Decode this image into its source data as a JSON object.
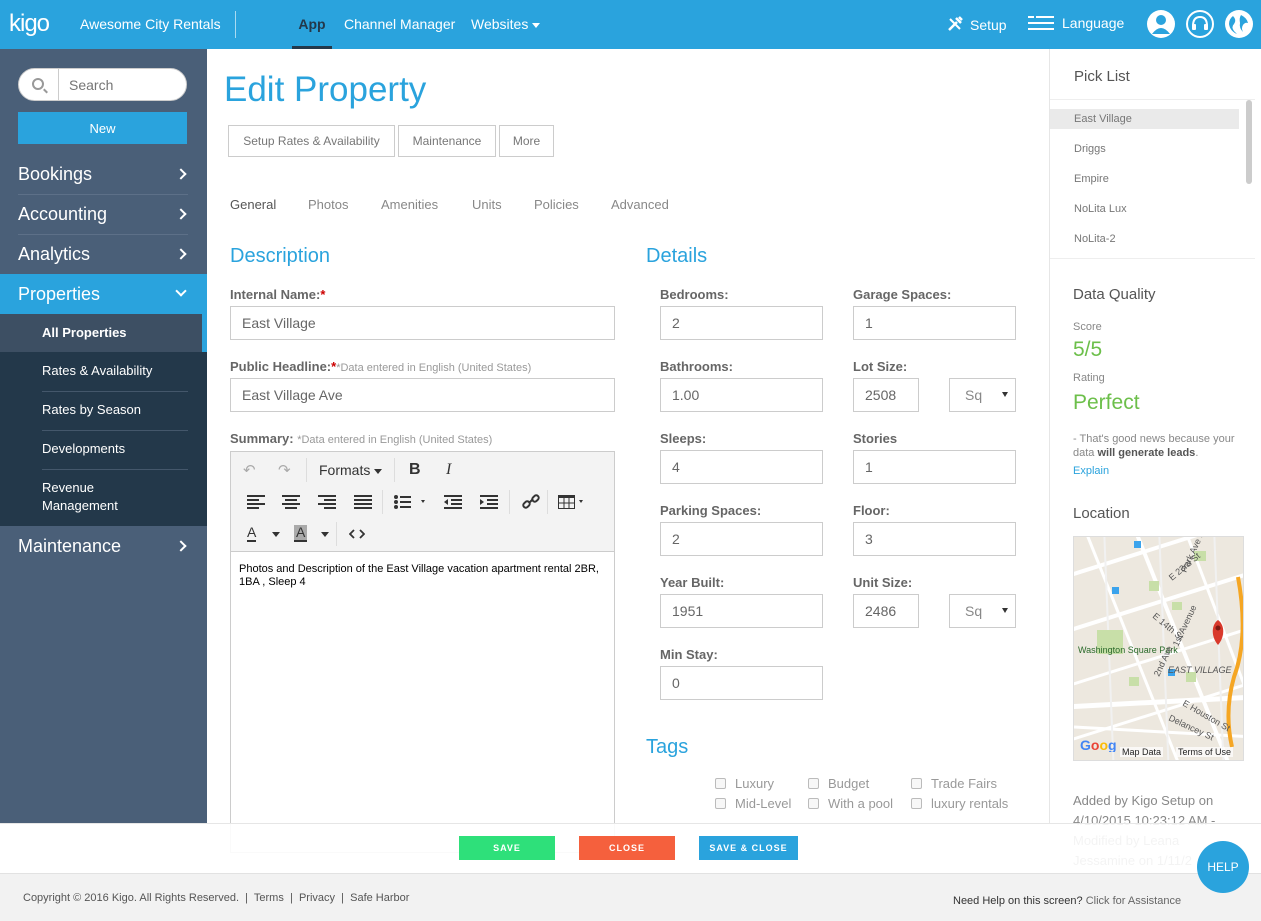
{
  "topbar": {
    "logo": "kigo",
    "company": "Awesome City Rentals",
    "nav": [
      {
        "label": "App"
      },
      {
        "label": "Channel Manager"
      },
      {
        "label": "Websites"
      }
    ],
    "setup": "Setup",
    "language": "Language"
  },
  "sidebar": {
    "search_placeholder": "Search",
    "new_label": "New",
    "items": [
      {
        "label": "Bookings"
      },
      {
        "label": "Accounting"
      },
      {
        "label": "Analytics"
      },
      {
        "label": "Properties"
      },
      {
        "label": "Maintenance"
      }
    ],
    "sub_items": [
      {
        "label": "All Properties"
      },
      {
        "label": "Rates & Availability"
      },
      {
        "label": "Rates by Season"
      },
      {
        "label": "Developments"
      },
      {
        "label": "Revenue Management"
      }
    ]
  },
  "main": {
    "title": "Edit Property",
    "actions": [
      {
        "label": "Setup Rates & Availability"
      },
      {
        "label": "Maintenance"
      },
      {
        "label": "More"
      }
    ],
    "tabs": [
      {
        "label": "General"
      },
      {
        "label": "Photos"
      },
      {
        "label": "Amenities"
      },
      {
        "label": "Units"
      },
      {
        "label": "Policies"
      },
      {
        "label": "Advanced"
      }
    ],
    "description": {
      "heading": "Description",
      "internal_name_label": "Internal Name:",
      "internal_name_value": "East Village",
      "headline_label": "Public Headline:",
      "headline_note": "*Data entered in English (United States)",
      "headline_value": "East Village Ave",
      "summary_label": "Summary:",
      "summary_note": "*Data entered in English (United States)",
      "formats_label": "Formats",
      "summary_text": "Photos and Description of the East Village vacation apartment rental 2BR, 1BA , Sleep 4"
    },
    "details": {
      "heading": "Details",
      "bedrooms_label": "Bedrooms:",
      "bedrooms": "2",
      "garage_label": "Garage Spaces:",
      "garage": "1",
      "bathrooms_label": "Bathrooms:",
      "bathrooms": "1.00",
      "lot_label": "Lot Size:",
      "lot": "2508",
      "lot_unit": "Sq",
      "sleeps_label": "Sleeps:",
      "sleeps": "4",
      "stories_label": "Stories",
      "stories": "1",
      "parking_label": "Parking Spaces:",
      "parking": "2",
      "floor_label": "Floor:",
      "floor": "3",
      "year_label": "Year Built:",
      "year": "1951",
      "unit_label": "Unit Size:",
      "unit": "2486",
      "unit_unit": "Sq",
      "minstay_label": "Min Stay:",
      "minstay": "0"
    },
    "tags": {
      "heading": "Tags",
      "items": [
        {
          "label": "Luxury"
        },
        {
          "label": "Budget"
        },
        {
          "label": "Trade Fairs"
        },
        {
          "label": "Mid-Level"
        },
        {
          "label": "With a pool"
        },
        {
          "label": "luxury rentals"
        }
      ]
    }
  },
  "right": {
    "pick_heading": "Pick List",
    "pick_items": [
      {
        "label": "East Village"
      },
      {
        "label": "Driggs"
      },
      {
        "label": "Empire"
      },
      {
        "label": "NoLita Lux"
      },
      {
        "label": "NoLita-2"
      }
    ],
    "dq_heading": "Data Quality",
    "score_label": "Score",
    "score": "5/5",
    "rating_label": "Rating",
    "rating": "Perfect",
    "dq_text": "- That's good news because your data",
    "dq_bold": "will generate leads",
    "explain": "Explain",
    "loc_heading": "Location",
    "map": {
      "labels": [
        "E 23rd St",
        "Park Ave S",
        "E 14th St",
        "1st Avenue",
        "Washington Square Park",
        "EAST VILLAGE",
        "2nd Ave",
        "E Houston St",
        "Delancey St"
      ],
      "map_data": "Map Data",
      "terms": "Terms of Use"
    },
    "added": "Added by Kigo Setup on 4/10/2015 10:23:12 AM - Modified by Leana Jessamine on 1/11/2"
  },
  "actions": {
    "save": "SAVE",
    "close": "CLOSE",
    "save_close": "SAVE & CLOSE"
  },
  "footer": {
    "copyright": "Copyright © 2016",
    "kigo": "Kigo.",
    "reserved": "All Rights Reserved.",
    "links": [
      {
        "label": "Terms"
      },
      {
        "label": "Privacy"
      },
      {
        "label": "Safe Harbor"
      }
    ],
    "help_q": "Need Help on this screen?",
    "help_link": "Click for Assistance",
    "help_bubble": "HELP"
  },
  "colors": {
    "accent": "#2aa3dd",
    "sidebar": "#4a5f78",
    "sidebar_dark": "#23384a",
    "save": "#2ee07a",
    "close": "#f5603d",
    "success": "#6cbf4a"
  }
}
